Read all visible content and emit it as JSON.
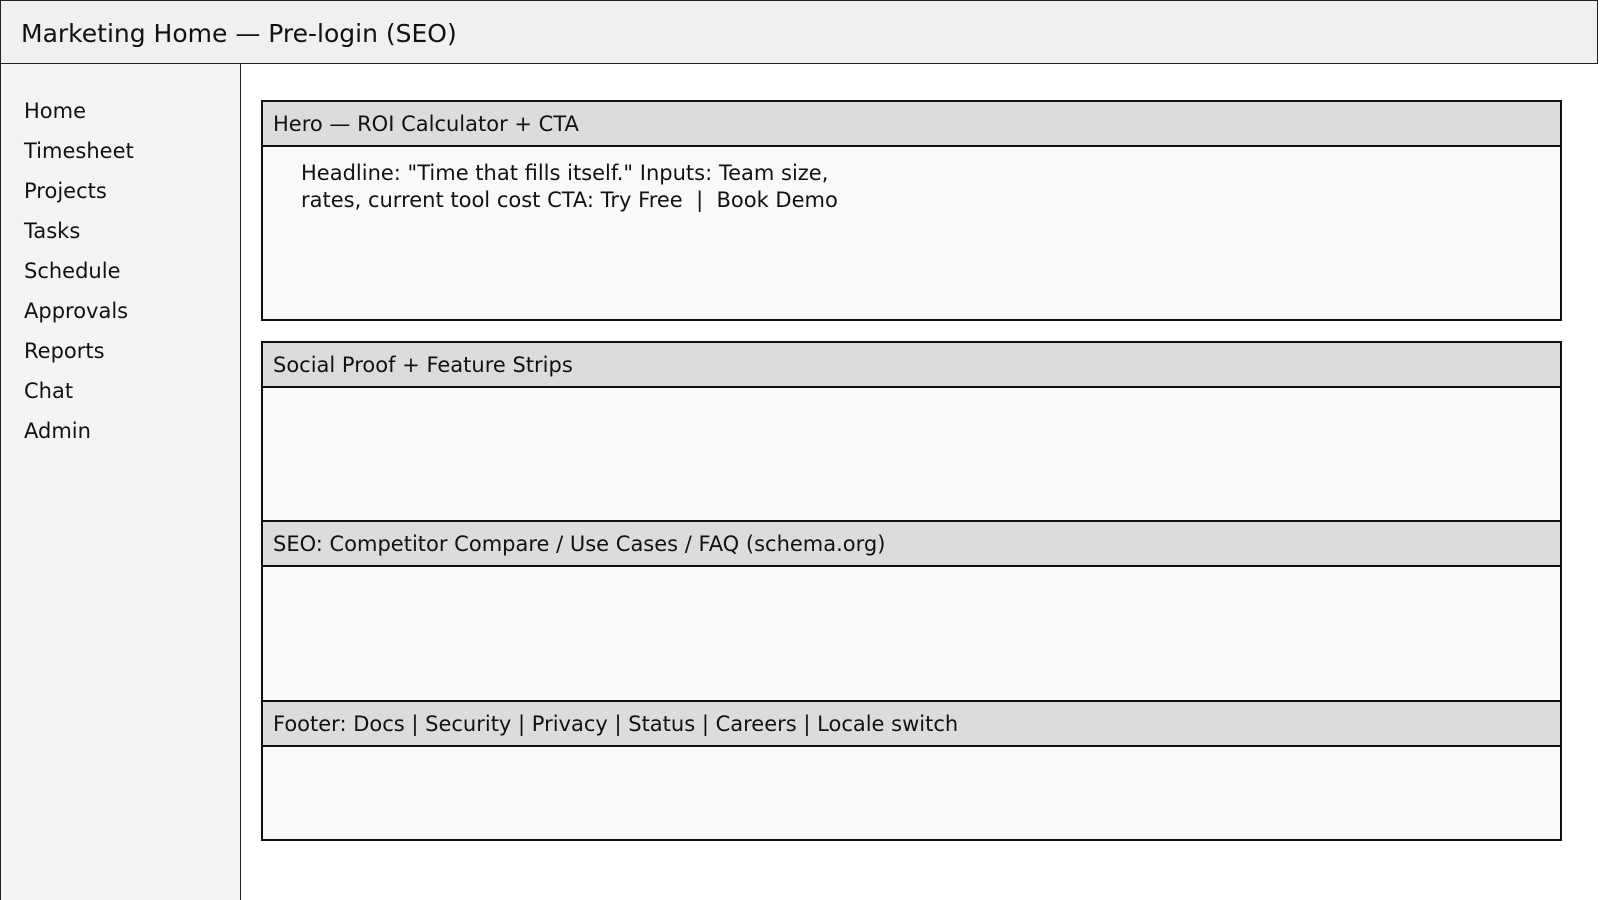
{
  "header": {
    "title": "Marketing Home — Pre-login (SEO)"
  },
  "sidebar": {
    "items": [
      {
        "label": "Home"
      },
      {
        "label": "Timesheet"
      },
      {
        "label": "Projects"
      },
      {
        "label": "Tasks"
      },
      {
        "label": "Schedule"
      },
      {
        "label": "Approvals"
      },
      {
        "label": "Reports"
      },
      {
        "label": "Chat"
      },
      {
        "label": "Admin"
      }
    ]
  },
  "panels": {
    "hero": {
      "title": "Hero — ROI Calculator + CTA",
      "lines": [
        "Headline: \"Time that fills itself.\" Inputs: Team size,",
        "rates, current tool cost CTA: Try Free  |  Book Demo"
      ]
    },
    "social": {
      "title": "Social Proof + Feature Strips"
    },
    "seo": {
      "title": "SEO: Competitor Compare / Use Cases / FAQ (schema.org)"
    },
    "footer": {
      "title": "Footer: Docs | Security | Privacy | Status | Careers | Locale switch"
    }
  }
}
